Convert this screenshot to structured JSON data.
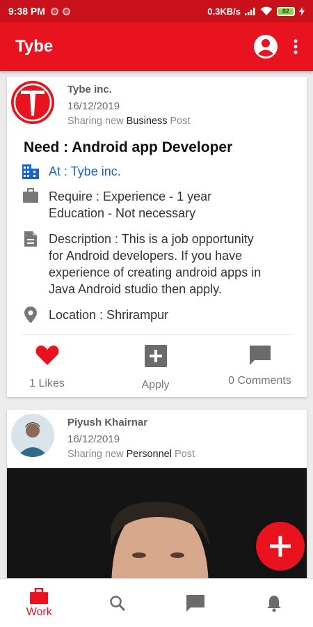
{
  "status_bar": {
    "time": "9:38 PM",
    "network_speed": "0.3KB/s",
    "battery": "82"
  },
  "app_bar": {
    "title": "Tybe",
    "icons": [
      "account-circle-icon",
      "more-vert-icon"
    ]
  },
  "posts": [
    {
      "author": "Tybe inc.",
      "date": "16/12/2019",
      "share_prefix": "Sharing new",
      "post_type": "Business",
      "share_suffix": "Post",
      "job_title": "Need : Android app Developer",
      "company": "At : Tybe inc.",
      "require_line1": "Require : Experience - 1 year",
      "require_line2": "Education - Not necessary",
      "description_line1": "Description : This is a job opportunity",
      "description_line2": "for Android developers. If you have",
      "description_line3": "experience of creating android apps in",
      "description_line4": "Java Android studio then apply.",
      "location": "Location : Shrirampur",
      "likes": "1 Likes",
      "apply": "Apply",
      "comments": "0 Comments"
    },
    {
      "author": "Piyush Khairnar",
      "date": "16/12/2019",
      "share_prefix": "Sharing new",
      "post_type": "Personnel",
      "share_suffix": "Post"
    }
  ],
  "bottom_nav": {
    "active": "Work",
    "items": [
      {
        "icon": "briefcase-icon",
        "label": "Work"
      },
      {
        "icon": "search-icon"
      },
      {
        "icon": "chat-icon"
      },
      {
        "icon": "bell-icon"
      }
    ]
  },
  "colors": {
    "brand_red": "#e8131e",
    "status_bar_red": "#c8111b",
    "link_blue": "#1c63c8"
  }
}
